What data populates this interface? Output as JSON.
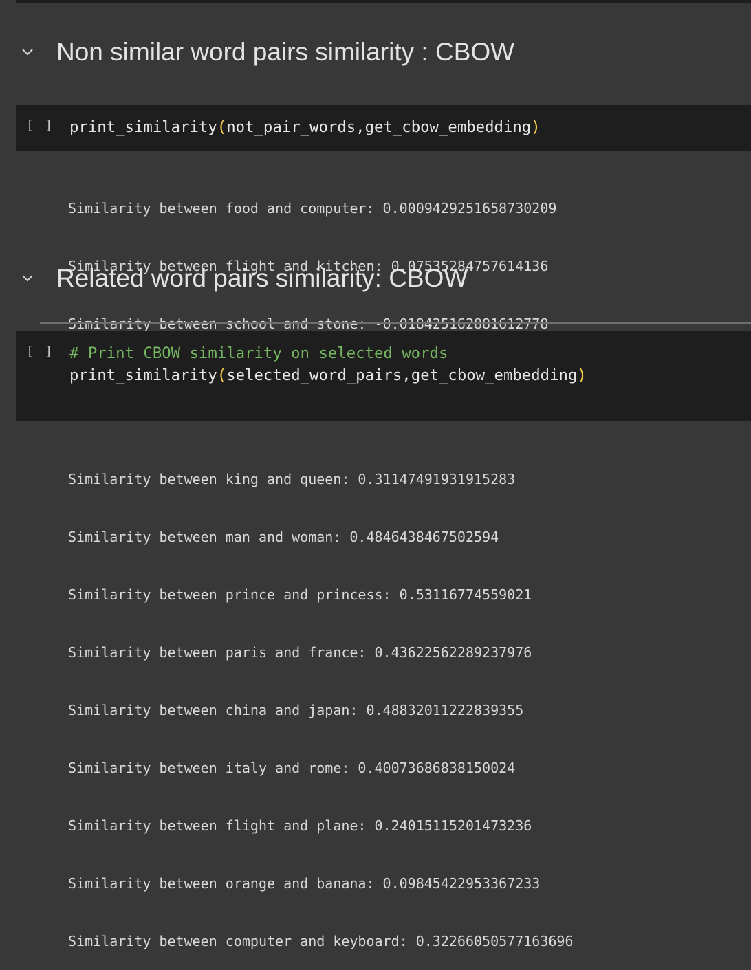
{
  "sections": [
    {
      "title": "Non similar word pairs similarity : CBOW",
      "cell": {
        "run_indicator": "[ ]",
        "comment": "",
        "code": {
          "fn": "print_similarity",
          "open": "(",
          "args": "not_pair_words,get_cbow_embedding",
          "close": ")"
        },
        "output": [
          "Similarity between food and computer: 0.0009429251658730209",
          "Similarity between flight and kitchen: 0.07535284757614136",
          "Similarity between school and stone: -0.018425162881612778"
        ]
      }
    },
    {
      "title": "Related word pairs similarity: CBOW",
      "cell": {
        "run_indicator": "[ ]",
        "comment": "# Print CBOW similarity on selected words",
        "code": {
          "fn": "print_similarity",
          "open": "(",
          "args": "selected_word_pairs,get_cbow_embedding",
          "close": ")"
        },
        "output": [
          "Similarity between king and queen: 0.31147491931915283",
          "Similarity between man and woman: 0.4846438467502594",
          "Similarity between prince and princess: 0.53116774559021",
          "Similarity between paris and france: 0.43622562289237976",
          "Similarity between china and japan: 0.48832011222839355",
          "Similarity between italy and rome: 0.40073686838150024",
          "Similarity between flight and plane: 0.24015115201473236",
          "Similarity between orange and banana: 0.09845422953367233",
          "Similarity between computer and keyboard: 0.32266050577163696"
        ]
      }
    }
  ],
  "colors": {
    "background": "#383838",
    "cell_background": "#1e1e1e",
    "paren": "#f6d24a",
    "comment": "#76b561"
  }
}
